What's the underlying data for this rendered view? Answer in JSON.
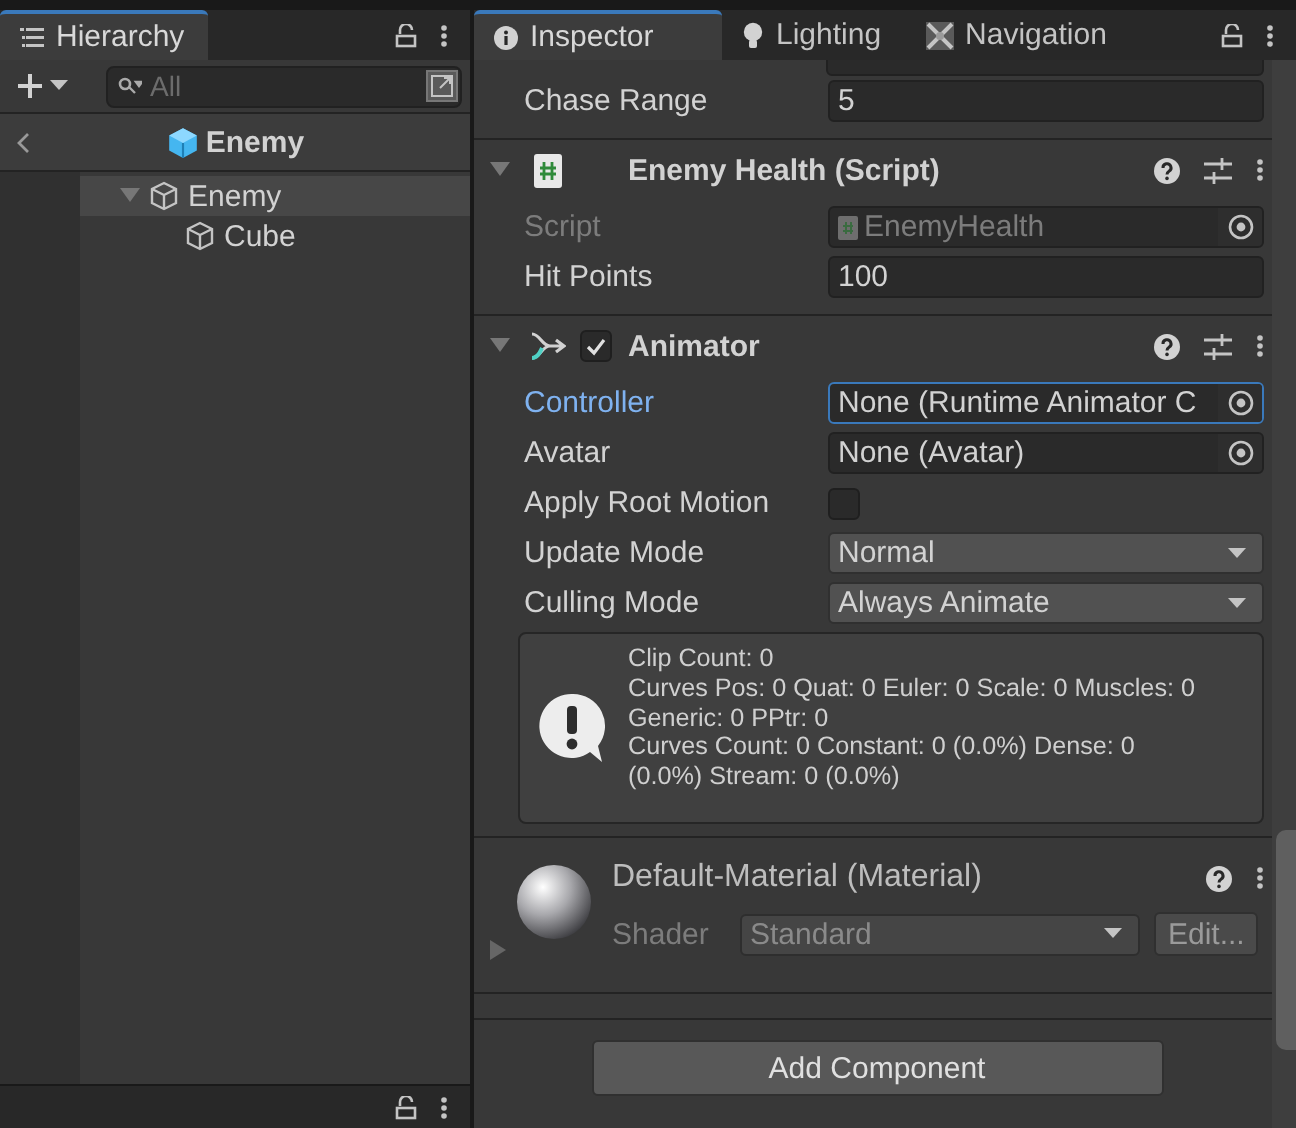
{
  "hierarchy": {
    "tab": {
      "label": "Hierarchy",
      "selected": true
    },
    "search": {
      "placeholder": "All"
    },
    "scene_header": {
      "title": "Enemy"
    },
    "tree": [
      {
        "label": "Enemy",
        "selected": true,
        "expanded": true,
        "children": [
          {
            "label": "Cube",
            "selected": false
          }
        ]
      }
    ]
  },
  "inspector": {
    "tabs": [
      {
        "label": "Inspector",
        "selected": true
      },
      {
        "label": "Lighting",
        "selected": false
      },
      {
        "label": "Navigation",
        "selected": false
      }
    ],
    "fields": [
      {
        "label": "Chase Range",
        "kind": "text",
        "value": "5"
      }
    ],
    "components": [
      {
        "title": "Enemy Health (Script)",
        "kind": "script",
        "expanded": true,
        "fields": [
          {
            "label": "Script",
            "kind": "script_ref",
            "value": "EnemyHealth",
            "disabled": true
          },
          {
            "label": "Hit Points",
            "kind": "text",
            "value": "100"
          }
        ]
      },
      {
        "title": "Animator",
        "kind": "animator",
        "expanded": true,
        "enabled": true,
        "fields": [
          {
            "label": "Controller",
            "kind": "object",
            "value": "None (Runtime Animator C",
            "focused": true
          },
          {
            "label": "Avatar",
            "kind": "object",
            "value": "None (Avatar)"
          },
          {
            "label": "Apply Root Motion",
            "kind": "checkbox",
            "checked": false
          },
          {
            "label": "Update Mode",
            "kind": "dropdown",
            "value": "Normal"
          },
          {
            "label": "Culling Mode",
            "kind": "dropdown",
            "value": "Always Animate"
          }
        ],
        "info": "Clip Count: 0\nCurves Pos: 0 Quat: 0 Euler: 0 Scale: 0 Muscles: 0\nGeneric: 0 PPtr: 0\nCurves Count: 0 Constant: 0 (0.0%) Dense: 0\n(0.0%) Stream: 0 (0.0%)"
      }
    ],
    "material": {
      "title": "Default-Material (Material)",
      "expanded": false,
      "shader_label": "Shader",
      "shader": "Standard",
      "edit_button": "Edit..."
    },
    "add_component": "Add Component"
  }
}
